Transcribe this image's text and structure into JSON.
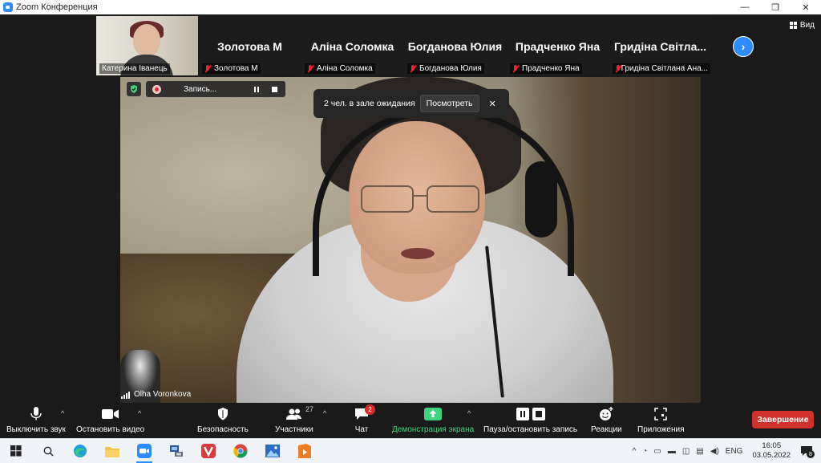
{
  "window": {
    "title": "Zoom Конференция",
    "minimize": "—",
    "maximize": "❐",
    "close": "✕"
  },
  "gallery": {
    "tiles": [
      {
        "name": "Катерина Іванець"
      },
      {
        "big": "Золотова М",
        "small": "Золотова М"
      },
      {
        "big": "Аліна Соломка",
        "small": "Аліна Соломка"
      },
      {
        "big": "Богданова Юлия",
        "small": "Богданова Юлия"
      },
      {
        "big": "Прадченко Яна",
        "small": "Прадченко Яна"
      },
      {
        "big": "Гридіна Світла...",
        "small": "Гридіна Світлана Ана..."
      }
    ],
    "next_icon": "›",
    "view_label": "Вид"
  },
  "recording": {
    "label": "Запись..."
  },
  "waiting_room": {
    "message": "2 чел. в зале ожидания",
    "view_label": "Посмотреть",
    "close": "✕"
  },
  "speaker": {
    "name": "Olha Voronkova"
  },
  "toolbar": {
    "mute": "Выключить звук",
    "video": "Остановить видео",
    "security": "Безопасность",
    "participants": "Участники",
    "participants_count": "27",
    "chat": "Чат",
    "chat_badge": "2",
    "share": "Демонстрация экрана",
    "record": "Пауза/остановить запись",
    "reactions": "Реакции",
    "apps": "Приложения",
    "end": "Завершение",
    "caret": "^"
  },
  "taskbar": {
    "lang": "ENG",
    "time": "16:05",
    "date": "03.05.2022",
    "notif_count": "8",
    "tray_chevron": "^"
  },
  "colors": {
    "zoom_blue": "#2D8CFF",
    "end_red": "#d0312d",
    "share_green": "#3fd37e",
    "muted_red": "#e02828"
  }
}
